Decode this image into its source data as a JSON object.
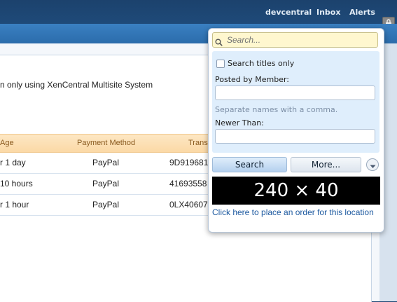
{
  "topnav": {
    "devcentral": "devcentral",
    "inbox": "Inbox",
    "alerts": "Alerts"
  },
  "message": "n only using XenCentral Multisite System",
  "table": {
    "headers": {
      "age": "Age",
      "payment": "Payment Method",
      "trans": "Transa"
    },
    "rows": [
      {
        "age": "r 1 day",
        "payment": "PayPal",
        "tx": "9D919681"
      },
      {
        "age": " 10 hours",
        "payment": "PayPal",
        "tx": "41693558"
      },
      {
        "age": "r 1 hour",
        "payment": "PayPal",
        "tx": "0LX40607"
      }
    ]
  },
  "search": {
    "placeholder": "Search...",
    "titles_only": "Search titles only",
    "posted_by": "Posted by Member:",
    "hint": "Separate names with a comma.",
    "newer_than": "Newer Than:",
    "search_btn": "Search",
    "more_btn": "More..."
  },
  "ad": {
    "size_label": "240 × 40",
    "link": "Click here to place an order for this location"
  }
}
